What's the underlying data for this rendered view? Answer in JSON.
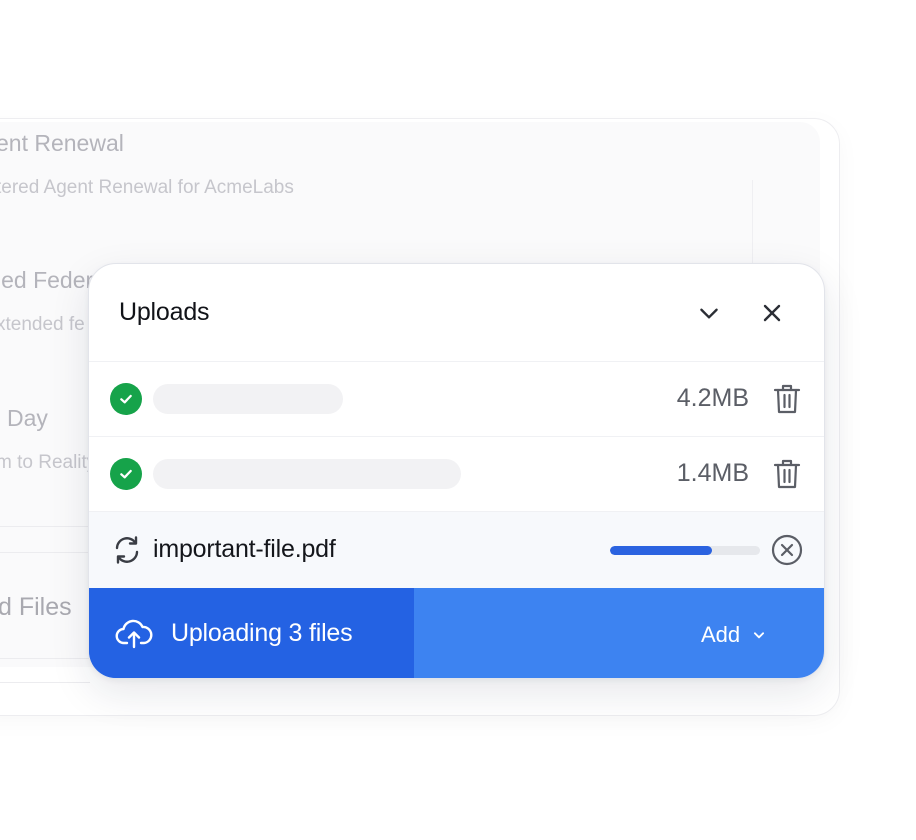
{
  "background": {
    "items": [
      {
        "title": "ent Renewal",
        "subtitle": "tered Agent Renewal for AcmeLabs"
      },
      {
        "title": "led Feder",
        "subtitle": "xtended fe"
      },
      {
        "title": "Day",
        "subtitle": "m to Reality"
      },
      {
        "title": "d Files"
      }
    ]
  },
  "uploads": {
    "title": "Uploads",
    "icons": {
      "collapse": "chevron-down-icon",
      "close": "close-icon"
    },
    "files": [
      {
        "status": "complete",
        "status_icon": "check-circle-icon",
        "size": "4.2MB",
        "action_icon": "trash-icon"
      },
      {
        "status": "complete",
        "status_icon": "check-circle-icon",
        "size": "1.4MB",
        "action_icon": "trash-icon"
      }
    ],
    "in_progress": {
      "name": "important-file.pdf",
      "status_icon": "sync-icon",
      "progress": 0.68,
      "action_icon": "cancel-circle-icon"
    },
    "footer": {
      "status_icon": "cloud-upload-icon",
      "status_text": "Uploading 3 files",
      "add_label": "Add",
      "add_icon": "chevron-down-icon"
    },
    "colors": {
      "success": "#16a34a",
      "accent": "#2462e3",
      "accent_light": "#3d83f1",
      "progress": "#2b63e0"
    }
  }
}
